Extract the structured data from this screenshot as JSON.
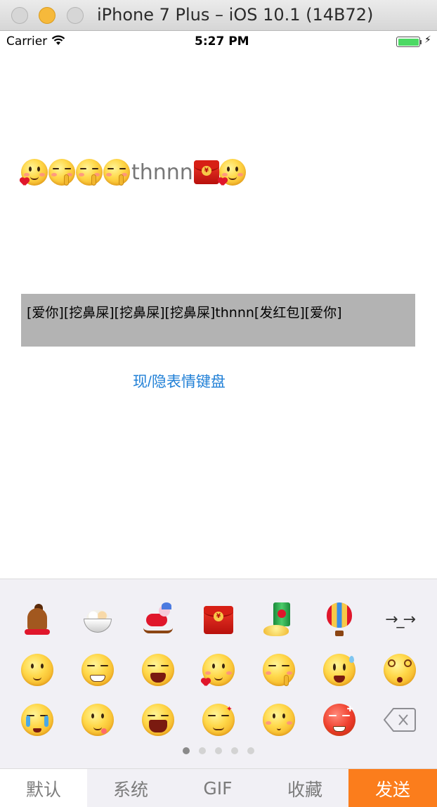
{
  "window": {
    "title": "iPhone 7 Plus – iOS 10.1 (14B72)"
  },
  "status_bar": {
    "carrier": "Carrier",
    "time": "5:27 PM",
    "battery_color": "#4cd964"
  },
  "main": {
    "rich_text_label": {
      "segments": [
        {
          "type": "emoji",
          "name": "love-you-emoji"
        },
        {
          "type": "emoji",
          "name": "pick-nose-emoji"
        },
        {
          "type": "emoji",
          "name": "pick-nose-emoji"
        },
        {
          "type": "emoji",
          "name": "pick-nose-emoji"
        },
        {
          "type": "text",
          "value": "thnnn"
        },
        {
          "type": "emoji",
          "name": "red-envelope-emoji"
        },
        {
          "type": "emoji",
          "name": "love-you-emoji"
        }
      ],
      "text": "thnnn"
    },
    "code_text": "[爱你][挖鼻屎][挖鼻屎][挖鼻屎]thnnn[发红包][爱你]",
    "code_box_color": "#b3b3b3",
    "toggle_button_label": "现/隐表情键盘",
    "toggle_button_color": "#1f7fd6"
  },
  "keyboard": {
    "background": "#f1f0f5",
    "rows": [
      [
        "horse-emoji",
        "rice-ball-bowl-emoji",
        "rocking-horse-emoji",
        "red-envelope-emoji",
        "beer-can-ingot-emoji",
        "hot-air-balloon-emoji",
        "arrow-icon"
      ],
      [
        "smile-emoji",
        "grin-emoji",
        "laugh-emoji",
        "love-you-emoji",
        "pick-nose-emoji",
        "shocked-emoji",
        "dizzy-emoji"
      ],
      [
        "crying-emoji",
        "tongue-emoji",
        "wail-emoji",
        "smirk-emoji",
        "shy-emoji",
        "angry-emoji",
        "delete-icon"
      ]
    ],
    "arrow_symbol": "→_→",
    "page_count": 5,
    "current_page": 1,
    "tabs": [
      {
        "label": "默认",
        "selected": true
      },
      {
        "label": "系统",
        "selected": false
      },
      {
        "label": "GIF",
        "selected": false
      },
      {
        "label": "收藏",
        "selected": false
      }
    ],
    "send_label": "发送",
    "send_color": "#fb7d1c"
  }
}
